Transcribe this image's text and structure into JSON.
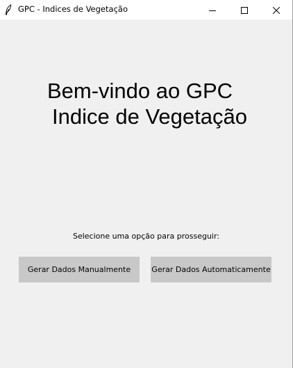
{
  "window": {
    "title": "GPC - Indices de Vegetação",
    "icon": "feather-icon",
    "controls": [
      "minimize-icon",
      "maximize-icon",
      "close-icon"
    ]
  },
  "main": {
    "heading_line1": "Bem-vindo ao GPC",
    "heading_line2": "Indice de Vegetação",
    "prompt": "Selecione uma opção para prosseguir:",
    "buttons": {
      "manual": "Gerar Dados Manualmente",
      "auto": "Gerar Dados Automaticamente"
    }
  },
  "colors": {
    "background": "#f0f0f0",
    "titlebar": "#ffffff",
    "button": "#c8c8c8"
  }
}
